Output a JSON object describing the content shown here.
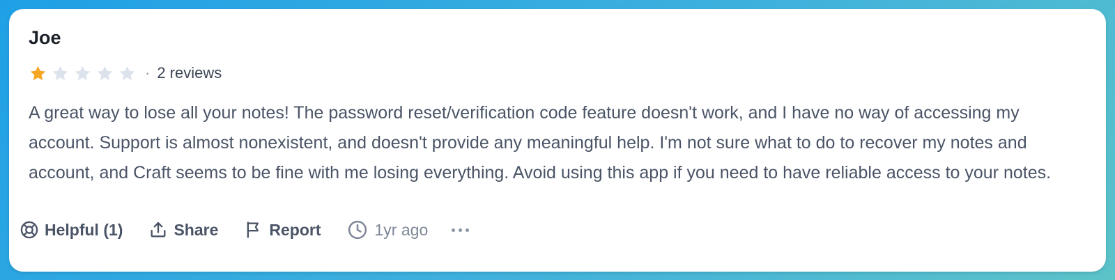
{
  "review": {
    "author": "Joe",
    "rating": 1,
    "rating_max": 5,
    "separator": "·",
    "review_count": "2 reviews",
    "text": "A great way to lose all your notes! The password reset/verification code feature doesn't work, and I have no way of accessing my account. Support is almost nonexistent, and doesn't provide any meaningful help. I'm not sure what to do to recover my notes and account, and Craft seems to be fine with me losing everything. Avoid using this app if you need to have reliable access to your notes."
  },
  "actions": {
    "helpful_label": "Helpful (1)",
    "share_label": "Share",
    "report_label": "Report",
    "time_label": "1yr ago"
  },
  "icons": {
    "helpful": "lifebuoy-icon",
    "share": "share-upload-icon",
    "report": "flag-icon",
    "time": "clock-icon",
    "more": "more-horizontal-icon",
    "star": "star-icon"
  },
  "colors": {
    "star_filled": "#f5a623",
    "star_empty": "#dde3ec",
    "text": "#4a5466",
    "name": "#1b1f27"
  }
}
